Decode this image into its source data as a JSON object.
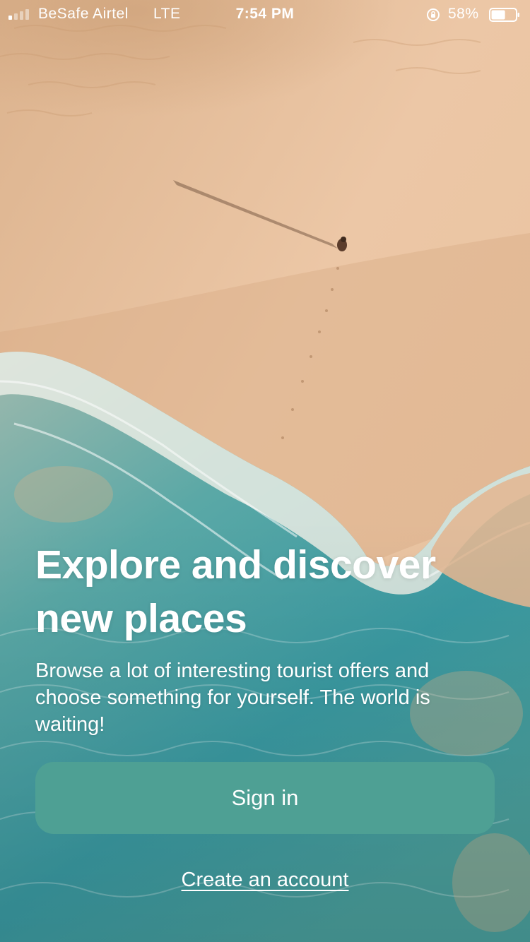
{
  "status_bar": {
    "carrier": "BeSafe Airtel",
    "network": "LTE",
    "time": "7:54 PM",
    "battery": "58%",
    "battery_level": 0.58,
    "icons": [
      "signal-icon",
      "orientation-lock-icon",
      "battery-icon"
    ]
  },
  "hero": {
    "background": "aerial-beach-photo",
    "headline": "Explore and discover new places",
    "subtitle": "Browse a lot of interesting tourist offers and choose something for yourself. The world is waiting!"
  },
  "actions": {
    "signin_label": "Sign in",
    "create_account_label": "Create an account"
  },
  "colors": {
    "button": "#4ea094",
    "sand": "#e6c3a0",
    "sea": "#3f9ea0",
    "text": "#ffffff"
  }
}
